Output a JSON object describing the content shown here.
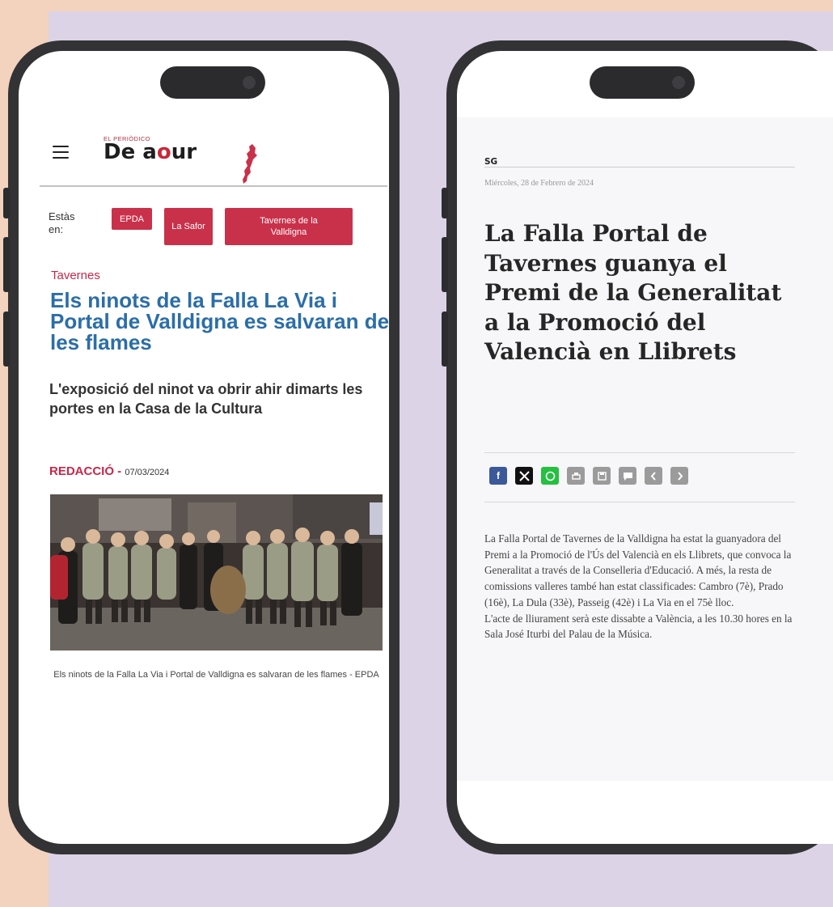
{
  "phone_left": {
    "logo": {
      "small_text": "EL PERIÒDICO",
      "main_text_de": "De a",
      "main_text_o": "o",
      "main_text_ur": "ur"
    },
    "breadcrumb": {
      "label": "Estàs en:",
      "items": [
        "EPDA",
        "La Safor",
        "Tavernes de la Valldigna"
      ]
    },
    "article": {
      "category": "Tavernes",
      "headline": "Els ninots de la Falla La Via i Portal de Valldigna es salvaran de les flames",
      "subheadline": "L'exposició del ninot va obrir ahir dimarts les portes en la Casa de la Cultura",
      "author": "REDACCIÓ -",
      "date": "07/03/2024",
      "image_caption": "Els ninots de la Falla La Via i Portal de Valldigna es salvaran de les flames - EPDA"
    }
  },
  "phone_right": {
    "author": "SG",
    "date": "Miércoles, 28 de Febrero de 2024",
    "headline": "La Falla Portal de Tavernes guanya el Premi de la Generalitat a la Promoció del Valencià en Llibrets",
    "share_icons": [
      "facebook-icon",
      "x-icon",
      "whatsapp-icon",
      "print-icon",
      "save-icon",
      "comment-icon",
      "previous-icon",
      "next-icon"
    ],
    "body_paragraph_1": "La Falla Portal de Tavernes de la Valldigna ha estat la guanyadora del Premi a la Promoció de l'Ús del Valencià en els Llibrets, que convoca la Generalitat a través de la Conselleria d'Educació. A més, la resta de comissions valleres també han estat classificades: Cambro (7è), Prado (16è), La Dula (33è), Passeig (42è) i La Via en el 75è lloc.",
    "body_paragraph_2": "L'acte de lliurament serà este dissabte a València, a les 10.30 hores en la Sala José Iturbi del Palau de la Música."
  },
  "colors": {
    "brand_red": "#c9314a",
    "headline_blue": "#2b6ea8",
    "background_peach": "#f3d2be",
    "background_lavender": "#dcd3e6"
  }
}
